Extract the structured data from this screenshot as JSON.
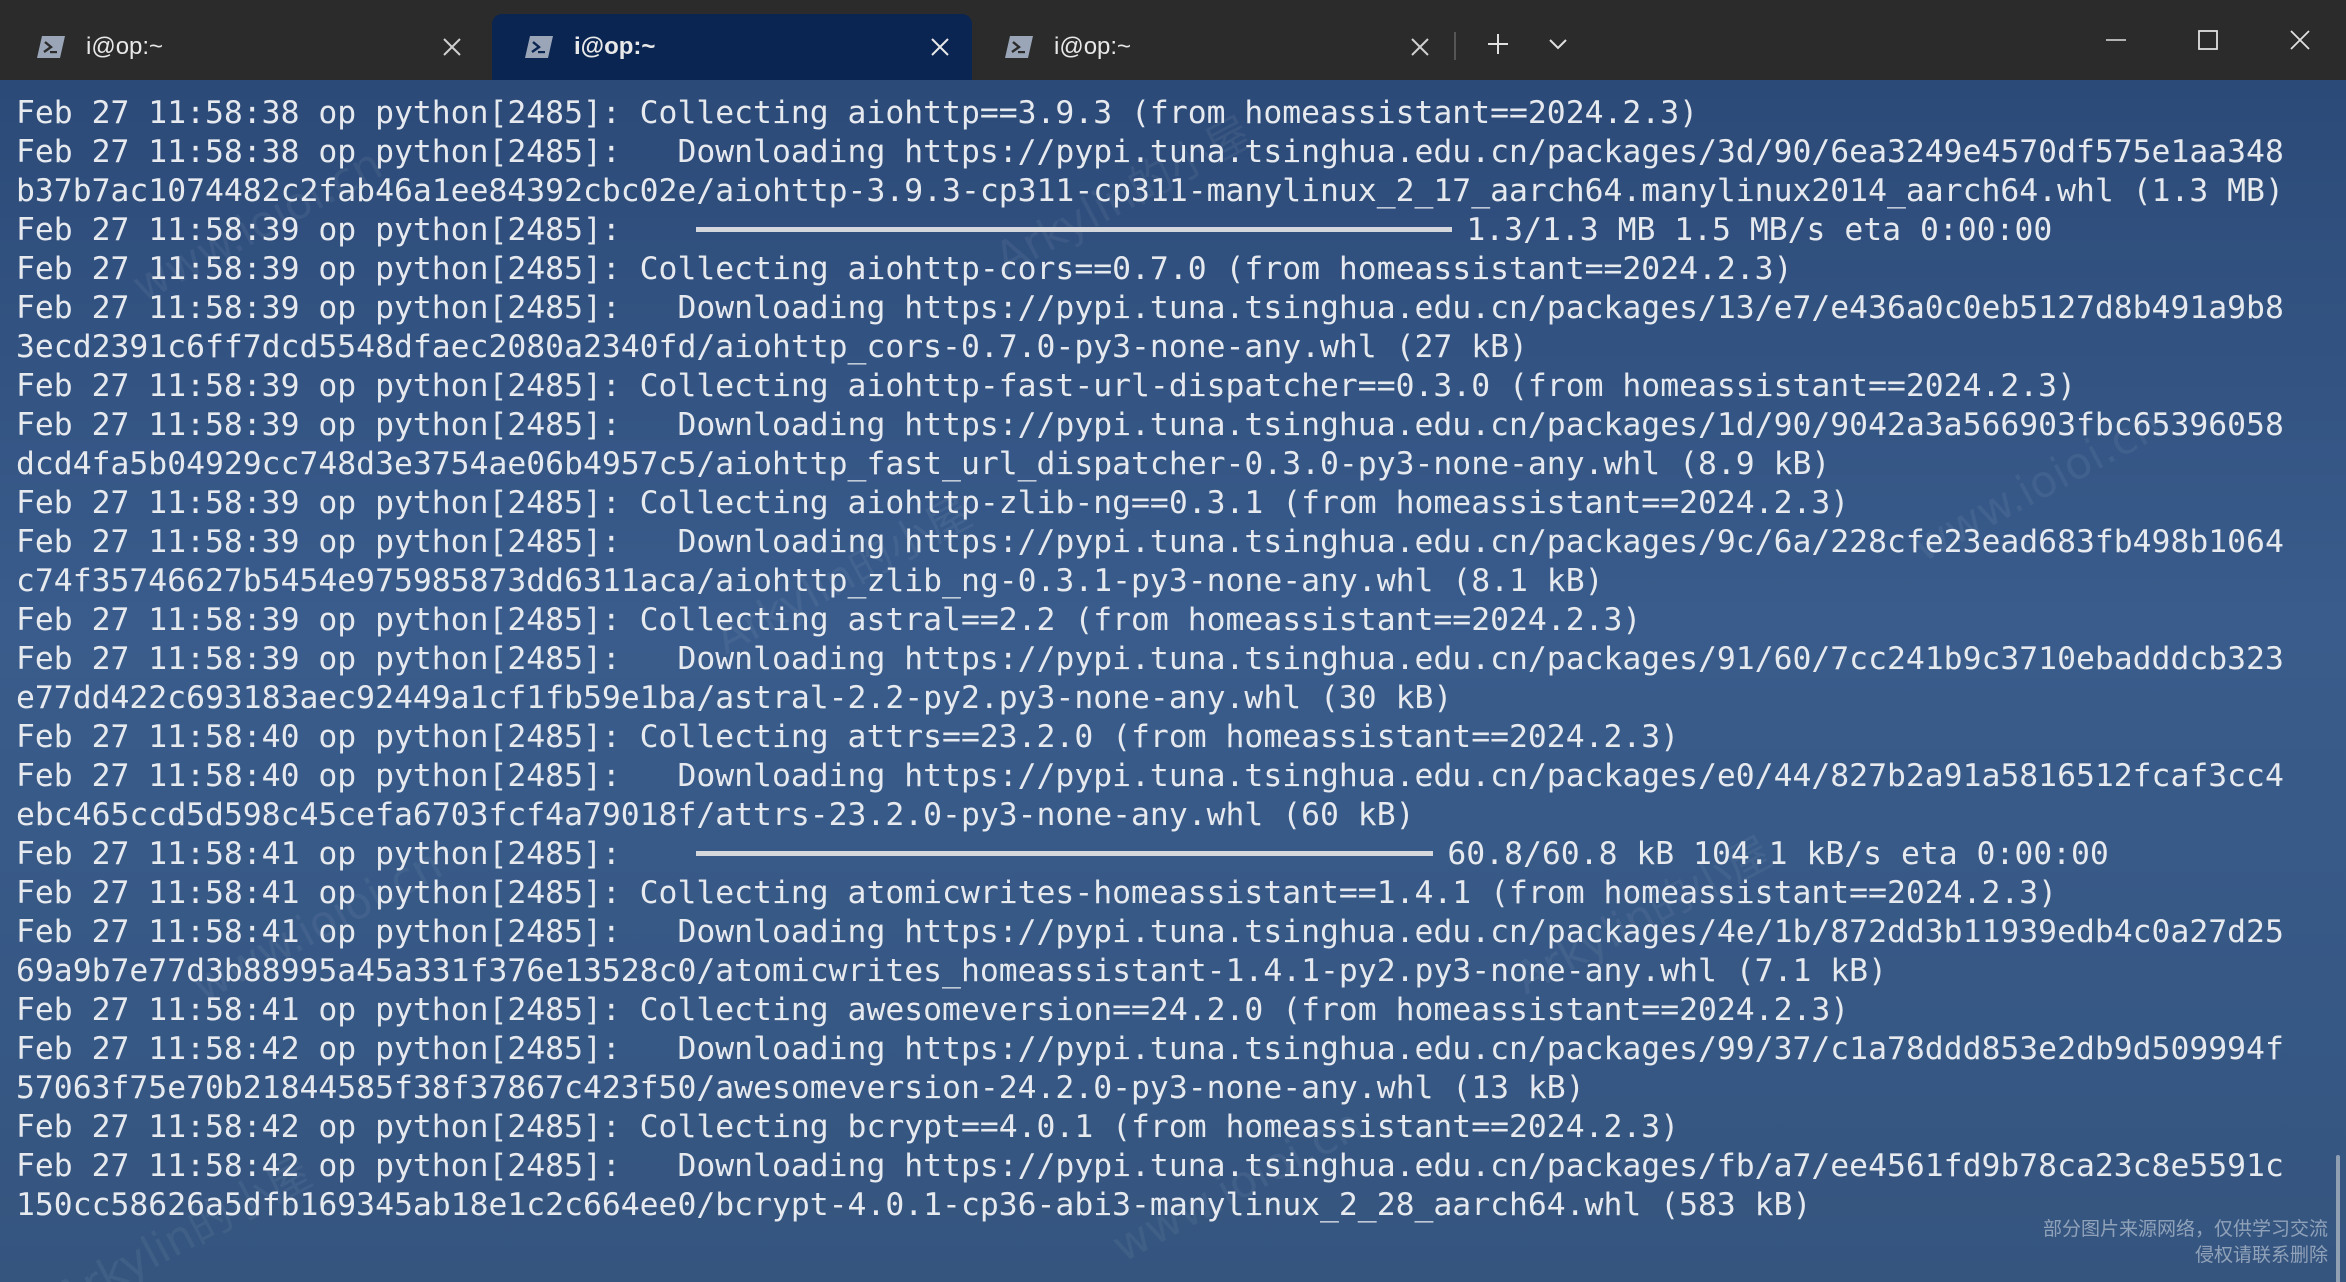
{
  "tabs": [
    {
      "label": "i@op:~",
      "active": false,
      "icon": "powershell-icon"
    },
    {
      "label": "i@op:~",
      "active": true,
      "icon": "powershell-icon"
    },
    {
      "label": "i@op:~",
      "active": false,
      "icon": "powershell-icon"
    }
  ],
  "terminal": {
    "lines": [
      {
        "text": "Feb 27 11:58:38 op python[2485]: Collecting aiohttp==3.9.3 (from homeassistant==2024.2.3)"
      },
      {
        "text": "Feb 27 11:58:38 op python[2485]:   Downloading https://pypi.tuna.tsinghua.edu.cn/packages/3d/90/6ea3249e4570df575e1aa348"
      },
      {
        "text": "b37b7ac1074482c2fab46a1ee84392cbc02e/aiohttp-3.9.3-cp311-cp311-manylinux_2_17_aarch64.manylinux2014_aarch64.whl (1.3 MB)"
      },
      {
        "text": "Feb 27 11:58:39 op python[2485]:",
        "progress": {
          "fraction": 1.0,
          "width_cols": 40,
          "status": "1.3/1.3 MB 1.5 MB/s eta 0:00:00"
        }
      },
      {
        "text": "Feb 27 11:58:39 op python[2485]: Collecting aiohttp-cors==0.7.0 (from homeassistant==2024.2.3)"
      },
      {
        "text": "Feb 27 11:58:39 op python[2485]:   Downloading https://pypi.tuna.tsinghua.edu.cn/packages/13/e7/e436a0c0eb5127d8b491a9b8"
      },
      {
        "text": "3ecd2391c6ff7dcd5548dfaec2080a2340fd/aiohttp_cors-0.7.0-py3-none-any.whl (27 kB)"
      },
      {
        "text": "Feb 27 11:58:39 op python[2485]: Collecting aiohttp-fast-url-dispatcher==0.3.0 (from homeassistant==2024.2.3)"
      },
      {
        "text": "Feb 27 11:58:39 op python[2485]:   Downloading https://pypi.tuna.tsinghua.edu.cn/packages/1d/90/9042a3a566903fbc65396058"
      },
      {
        "text": "dcd4fa5b04929cc748d3e3754ae06b4957c5/aiohttp_fast_url_dispatcher-0.3.0-py3-none-any.whl (8.9 kB)"
      },
      {
        "text": "Feb 27 11:58:39 op python[2485]: Collecting aiohttp-zlib-ng==0.3.1 (from homeassistant==2024.2.3)"
      },
      {
        "text": "Feb 27 11:58:39 op python[2485]:   Downloading https://pypi.tuna.tsinghua.edu.cn/packages/9c/6a/228cfe23ead683fb498b1064"
      },
      {
        "text": "c74f35746627b5454e975985873dd6311aca/aiohttp_zlib_ng-0.3.1-py3-none-any.whl (8.1 kB)"
      },
      {
        "text": "Feb 27 11:58:39 op python[2485]: Collecting astral==2.2 (from homeassistant==2024.2.3)"
      },
      {
        "text": "Feb 27 11:58:39 op python[2485]:   Downloading https://pypi.tuna.tsinghua.edu.cn/packages/91/60/7cc241b9c3710ebadddcb323"
      },
      {
        "text": "e77dd422c693183aec92449a1cf1fb59e1ba/astral-2.2-py2.py3-none-any.whl (30 kB)"
      },
      {
        "text": "Feb 27 11:58:40 op python[2485]: Collecting attrs==23.2.0 (from homeassistant==2024.2.3)"
      },
      {
        "text": "Feb 27 11:58:40 op python[2485]:   Downloading https://pypi.tuna.tsinghua.edu.cn/packages/e0/44/827b2a91a5816512fcaf3cc4"
      },
      {
        "text": "ebc465ccd5d598c45cefa6703fcf4a79018f/attrs-23.2.0-py3-none-any.whl (60 kB)"
      },
      {
        "text": "Feb 27 11:58:41 op python[2485]:",
        "progress": {
          "fraction": 1.0,
          "width_cols": 39,
          "status": "60.8/60.8 kB 104.1 kB/s eta 0:00:00"
        }
      },
      {
        "text": "Feb 27 11:58:41 op python[2485]: Collecting atomicwrites-homeassistant==1.4.1 (from homeassistant==2024.2.3)"
      },
      {
        "text": "Feb 27 11:58:41 op python[2485]:   Downloading https://pypi.tuna.tsinghua.edu.cn/packages/4e/1b/872dd3b11939edb4c0a27d25"
      },
      {
        "text": "69a9b7e77d3b88995a45a331f376e13528c0/atomicwrites_homeassistant-1.4.1-py2.py3-none-any.whl (7.1 kB)"
      },
      {
        "text": "Feb 27 11:58:41 op python[2485]: Collecting awesomeversion==24.2.0 (from homeassistant==2024.2.3)"
      },
      {
        "text": "Feb 27 11:58:42 op python[2485]:   Downloading https://pypi.tuna.tsinghua.edu.cn/packages/99/37/c1a78ddd853e2db9d509994f"
      },
      {
        "text": "57063f75e70b21844585f38f37867c423f50/awesomeversion-24.2.0-py3-none-any.whl (13 kB)"
      },
      {
        "text": "Feb 27 11:58:42 op python[2485]: Collecting bcrypt==4.0.1 (from homeassistant==2024.2.3)"
      },
      {
        "text": "Feb 27 11:58:42 op python[2485]:   Downloading https://pypi.tuna.tsinghua.edu.cn/packages/fb/a7/ee4561fd9b78ca23c8e5591c"
      },
      {
        "text": "150cc58626a5dfb169345ab18e1c2c664ee0/bcrypt-4.0.1-cp36-abi3-manylinux_2_28_aarch64.whl (583 kB)"
      }
    ]
  },
  "watermarks": [
    "www.ioioi.cn",
    "Arkylin的小屋"
  ],
  "notice": {
    "line1": "部分图片来源网络，仅供学习交流",
    "line2": "侵权请联系删除"
  },
  "colors": {
    "titlebar": "#2b2b2b",
    "active_tab": "#0a2552",
    "terminal_bg": "#395c8c",
    "text": "#e6e9ee"
  }
}
